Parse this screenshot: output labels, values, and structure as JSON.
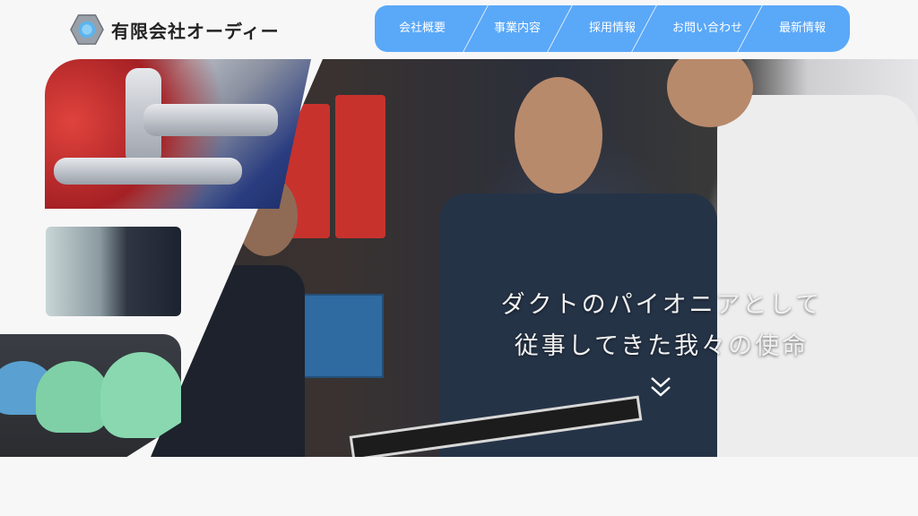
{
  "header": {
    "logo_icon": "hex-nut-icon",
    "company_name": "有限会社オーディー"
  },
  "nav": {
    "items": [
      {
        "label": "会社概要"
      },
      {
        "label": "事業内容"
      },
      {
        "label": "採用情報"
      },
      {
        "label": "お問い合わせ"
      },
      {
        "label": "最新情報"
      }
    ],
    "color": "#5aa8f8"
  },
  "hero": {
    "copy_line1": "ダクトのパイオニアとして",
    "copy_line2": "従事してきた我々の使命",
    "scroll_icon": "double-chevron-down-icon"
  }
}
